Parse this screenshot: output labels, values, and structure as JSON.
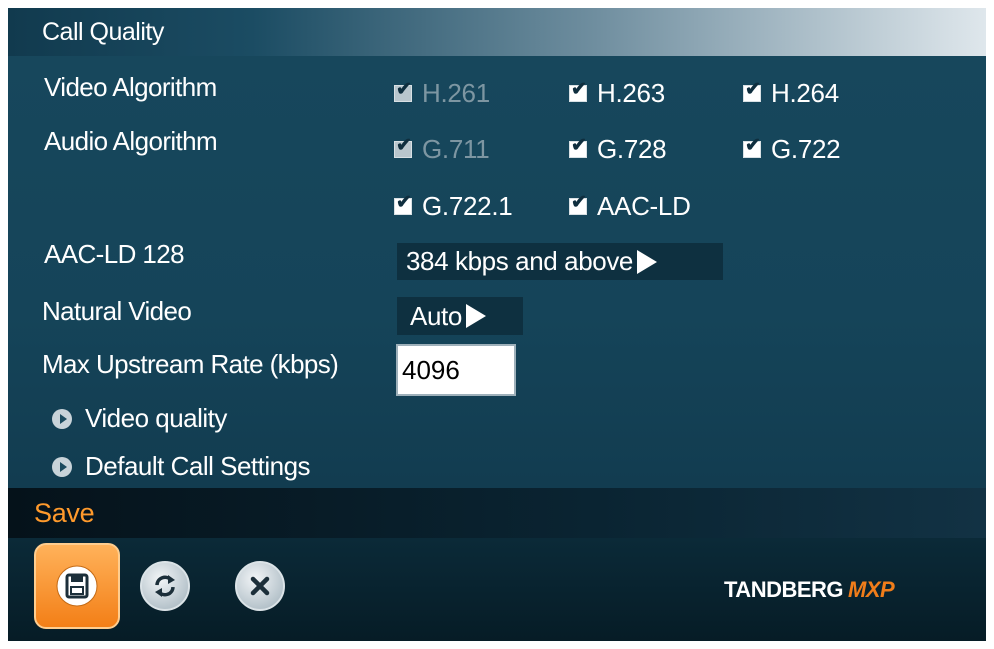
{
  "header": {
    "title": "Call Quality"
  },
  "video_algorithm": {
    "label": "Video Algorithm",
    "options": [
      {
        "label": "H.261",
        "checked": true,
        "disabled": true
      },
      {
        "label": "H.263",
        "checked": true,
        "disabled": false
      },
      {
        "label": "H.264",
        "checked": true,
        "disabled": false
      }
    ]
  },
  "audio_algorithm": {
    "label": "Audio Algorithm",
    "options": [
      {
        "label": "G.711",
        "checked": true,
        "disabled": true
      },
      {
        "label": "G.728",
        "checked": true,
        "disabled": false
      },
      {
        "label": "G.722",
        "checked": true,
        "disabled": false
      },
      {
        "label": "G.722.1",
        "checked": true,
        "disabled": false
      },
      {
        "label": "AAC-LD",
        "checked": true,
        "disabled": false
      }
    ]
  },
  "aac_ld_128": {
    "label": "AAC-LD 128",
    "value": "384 kbps and above"
  },
  "natural_video": {
    "label": "Natural Video",
    "value": "Auto"
  },
  "max_upstream": {
    "label": "Max Upstream Rate (kbps)",
    "value": "4096"
  },
  "links": {
    "video_quality": "Video quality",
    "default_call_settings": "Default Call Settings"
  },
  "save_bar": {
    "title": "Save"
  },
  "toolbar": {
    "icons": [
      "save-icon",
      "refresh-icon",
      "cancel-icon"
    ]
  },
  "brand": {
    "name": "TANDBERG",
    "suffix": "MXP"
  },
  "colors": {
    "panel": "#123e53",
    "accent_orange": "#f37f17",
    "text": "#ffffff",
    "disabled_text": "#7d96a2"
  }
}
